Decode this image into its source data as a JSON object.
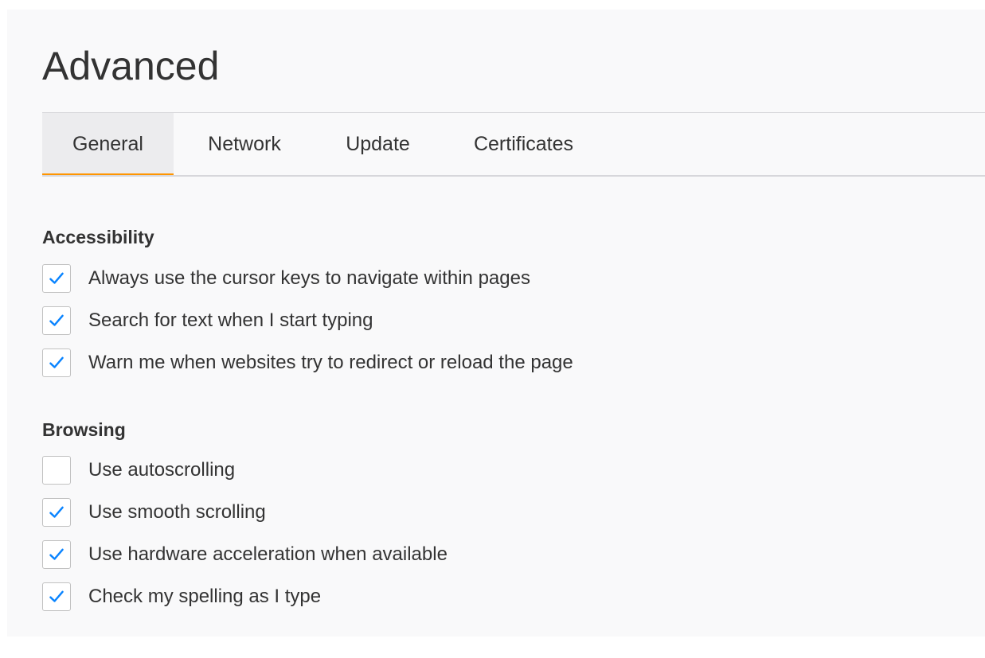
{
  "page": {
    "title": "Advanced"
  },
  "tabs": [
    {
      "label": "General",
      "selected": true
    },
    {
      "label": "Network",
      "selected": false
    },
    {
      "label": "Update",
      "selected": false
    },
    {
      "label": "Certificates",
      "selected": false
    }
  ],
  "sections": {
    "accessibility": {
      "title": "Accessibility",
      "options": [
        {
          "label": "Always use the cursor keys to navigate within pages",
          "checked": true
        },
        {
          "label": "Search for text when I start typing",
          "checked": true
        },
        {
          "label": "Warn me when websites try to redirect or reload the page",
          "checked": true
        }
      ]
    },
    "browsing": {
      "title": "Browsing",
      "options": [
        {
          "label": "Use autoscrolling",
          "checked": false
        },
        {
          "label": "Use smooth scrolling",
          "checked": true
        },
        {
          "label": "Use hardware acceleration when available",
          "checked": true
        },
        {
          "label": "Check my spelling as I type",
          "checked": true
        }
      ]
    }
  },
  "colors": {
    "accent": "#ff9500",
    "check": "#0a84ff",
    "background": "#f9f9fa",
    "text": "#333333"
  },
  "icons": {
    "checkmark": "checkmark-icon"
  }
}
